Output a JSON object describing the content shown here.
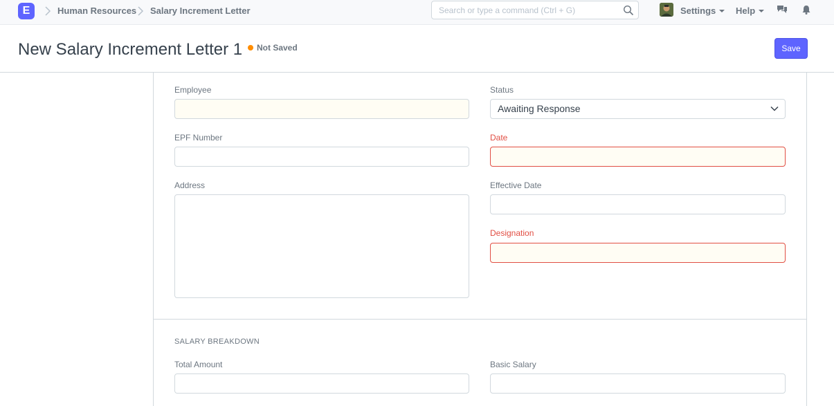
{
  "navbar": {
    "logo_letter": "E",
    "breadcrumbs": [
      "Human Resources",
      "Salary Increment Letter"
    ],
    "search_placeholder": "Search or type a command (Ctrl + G)",
    "settings_label": "Settings",
    "help_label": "Help"
  },
  "page_head": {
    "title": "New Salary Increment Letter 1",
    "indicator": "Not Saved",
    "save_label": "Save"
  },
  "form": {
    "employee": {
      "label": "Employee",
      "value": ""
    },
    "status": {
      "label": "Status",
      "value": "Awaiting Response"
    },
    "epf_number": {
      "label": "EPF Number",
      "value": ""
    },
    "date": {
      "label": "Date",
      "value": ""
    },
    "address": {
      "label": "Address",
      "value": ""
    },
    "effective_date": {
      "label": "Effective Date",
      "value": ""
    },
    "designation": {
      "label": "Designation",
      "value": ""
    }
  },
  "salary_section": {
    "heading": "SALARY BREAKDOWN",
    "total_amount": {
      "label": "Total Amount",
      "value": ""
    },
    "basic_salary": {
      "label": "Basic Salary",
      "value": ""
    }
  },
  "colors": {
    "primary": "#5e64ff",
    "not_saved": "#ff8d00",
    "required_error": "#e14e43"
  }
}
